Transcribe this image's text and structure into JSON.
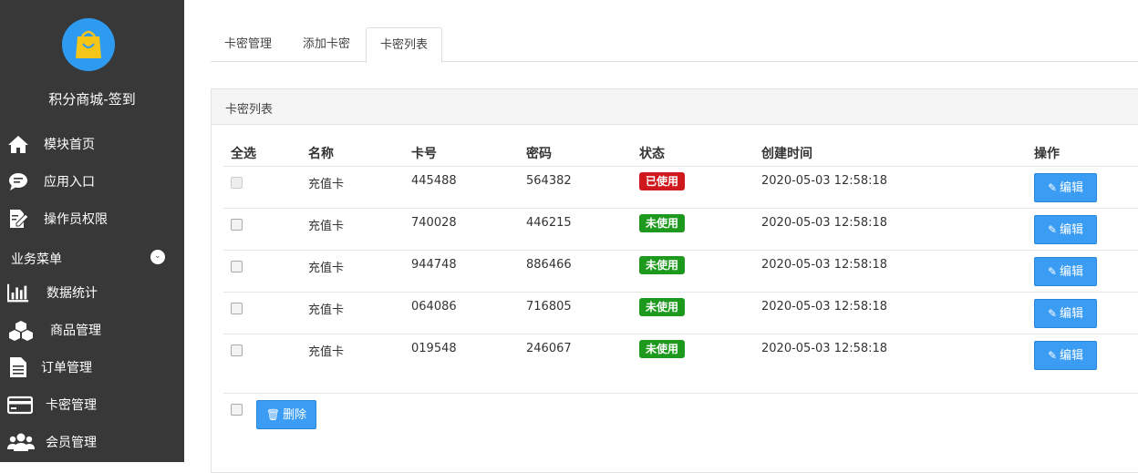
{
  "sidebar": {
    "brand": "积分商城-签到",
    "logo_icon": "shopping-bag-icon",
    "items": [
      {
        "label": "模块首页",
        "icon": "home-icon"
      },
      {
        "label": "应用入口",
        "icon": "chat-bubble-icon"
      },
      {
        "label": "操作员权限",
        "icon": "edit-document-icon"
      }
    ],
    "section_title": "业务菜单",
    "section_icon": "chevron-down-icon",
    "business_items": [
      {
        "label": "数据统计",
        "icon": "bar-chart-icon"
      },
      {
        "label": "商品管理",
        "icon": "cubes-icon"
      },
      {
        "label": "订单管理",
        "icon": "file-text-icon"
      },
      {
        "label": "卡密管理",
        "icon": "credit-card-icon"
      },
      {
        "label": "会员管理",
        "icon": "users-icon"
      }
    ]
  },
  "tabs": [
    {
      "label": "卡密管理",
      "active": false
    },
    {
      "label": "添加卡密",
      "active": false
    },
    {
      "label": "卡密列表",
      "active": true
    }
  ],
  "panel": {
    "title": "卡密列表"
  },
  "table": {
    "headers": [
      "全选",
      "名称",
      "卡号",
      "密码",
      "状态",
      "创建时间",
      "操作"
    ],
    "rows": [
      {
        "name": "充值卡",
        "card": "445488",
        "password": "564382",
        "status": "已使用",
        "created": "2020-05-03 12:58:18",
        "action": "编辑",
        "used": true
      },
      {
        "name": "充值卡",
        "card": "740028",
        "password": "446215",
        "status": "未使用",
        "created": "2020-05-03 12:58:18",
        "action": "编辑",
        "used": false
      },
      {
        "name": "充值卡",
        "card": "944748",
        "password": "886466",
        "status": "未使用",
        "created": "2020-05-03 12:58:18",
        "action": "编辑",
        "used": false
      },
      {
        "name": "充值卡",
        "card": "064086",
        "password": "716805",
        "status": "未使用",
        "created": "2020-05-03 12:58:18",
        "action": "编辑",
        "used": false
      },
      {
        "name": "充值卡",
        "card": "019548",
        "password": "246067",
        "status": "未使用",
        "created": "2020-05-03 12:58:18",
        "action": "编辑",
        "used": false
      }
    ]
  },
  "footer": {
    "delete_label": "删除",
    "delete_icon": "trash-icon"
  },
  "colors": {
    "sidebar_bg": "#383838",
    "primary": "#3a9cf2",
    "used": "#d0191d",
    "unused": "#1d9a1d"
  }
}
